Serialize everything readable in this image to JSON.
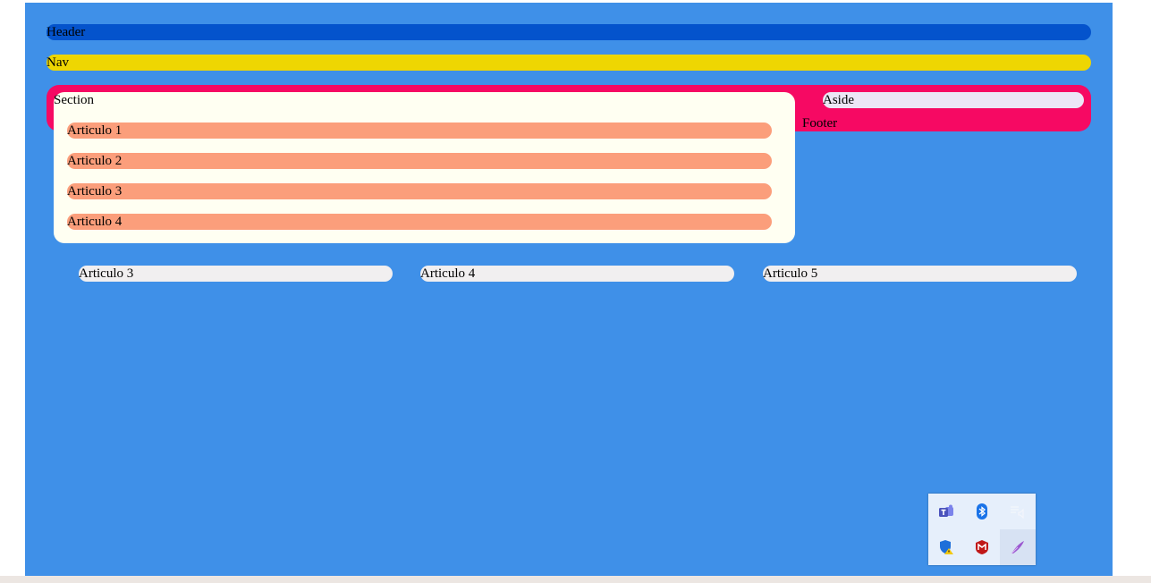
{
  "header": {
    "label": "Header"
  },
  "nav": {
    "label": "Nav"
  },
  "section": {
    "label": "Section",
    "articles": [
      {
        "label": "Articulo 1"
      },
      {
        "label": "Articulo 2"
      },
      {
        "label": "Articulo 3"
      },
      {
        "label": "Articulo 4"
      }
    ]
  },
  "aside": {
    "label": "Aside"
  },
  "footer": {
    "label": "Footer"
  },
  "bottom_articles": [
    {
      "label": "Articulo 3"
    },
    {
      "label": "Articulo 4"
    },
    {
      "label": "Articulo 5"
    }
  ],
  "tray": {
    "icons": [
      "teams-icon",
      "bluetooth-icon",
      "display-sound-icon",
      "security-warning-icon",
      "mcafee-icon",
      "pen-icon"
    ]
  },
  "colors": {
    "page_bg": "#3f90e8",
    "header": "#0453cc",
    "nav": "#eed602",
    "main": "#f60963",
    "section": "#fffff2",
    "article": "#fb9e7b",
    "aside": "#ece6f6",
    "bottom_article": "#f1eff0"
  }
}
